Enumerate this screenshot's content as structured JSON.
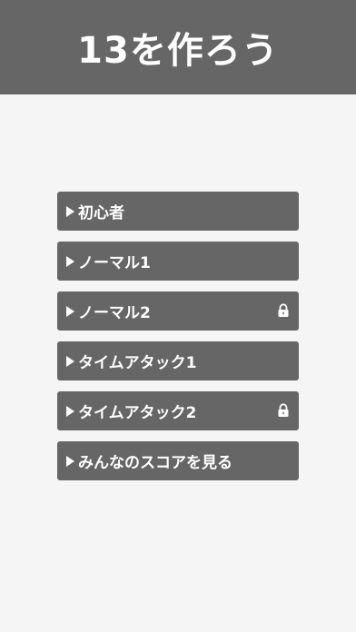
{
  "header": {
    "title": "13を作ろう"
  },
  "menu": {
    "items": [
      {
        "label": "初心者",
        "locked": false
      },
      {
        "label": "ノーマル1",
        "locked": false
      },
      {
        "label": "ノーマル2",
        "locked": true
      },
      {
        "label": "タイムアタック1",
        "locked": false
      },
      {
        "label": "タイムアタック2",
        "locked": true
      },
      {
        "label": "みんなのスコアを見る",
        "locked": false
      }
    ]
  },
  "colors": {
    "header_bg": "#666666",
    "button_bg": "#666666",
    "page_bg": "#f5f5f5",
    "text": "#ffffff"
  },
  "icons": {
    "arrow": "play-arrow-icon",
    "lock": "lock-icon"
  }
}
